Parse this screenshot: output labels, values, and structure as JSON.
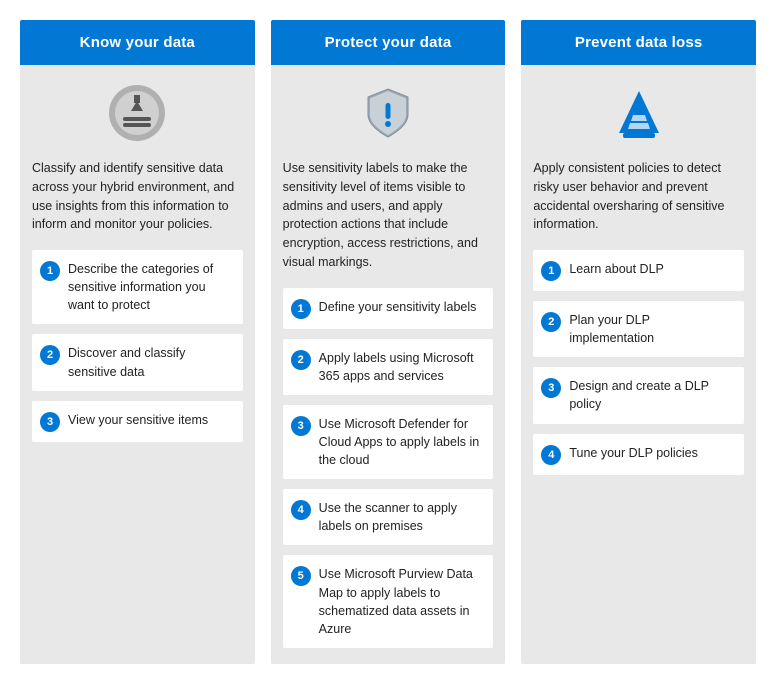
{
  "columns": [
    {
      "id": "know-your-data",
      "header": "Know your data",
      "icon": "database-download",
      "description": "Classify and identify sensitive data across your hybrid environment, and use insights from this information to inform and monitor your policies.",
      "steps": [
        "Describe the categories of sensitive information you want to protect",
        "Discover and classify sensitive data",
        "View your sensitive items"
      ]
    },
    {
      "id": "protect-your-data",
      "header": "Protect your data",
      "icon": "shield-alert",
      "description": "Use sensitivity labels to make the sensitivity level of items visible to admins and users, and apply protection actions that include encryption, access restrictions, and visual markings.",
      "steps": [
        "Define your sensitivity labels",
        "Apply labels using Microsoft 365 apps and services",
        "Use Microsoft Defender for Cloud Apps to apply labels in the cloud",
        "Use the scanner to apply labels on premises",
        "Use Microsoft Purview Data Map to apply labels to schematized data assets in Azure"
      ]
    },
    {
      "id": "prevent-data-loss",
      "header": "Prevent data loss",
      "icon": "cone-warning",
      "description": "Apply consistent policies to detect risky user behavior and prevent accidental oversharing of sensitive information.",
      "steps": [
        "Learn about DLP",
        "Plan your DLP implementation",
        "Design and create a DLP policy",
        "Tune your DLP policies"
      ]
    }
  ]
}
